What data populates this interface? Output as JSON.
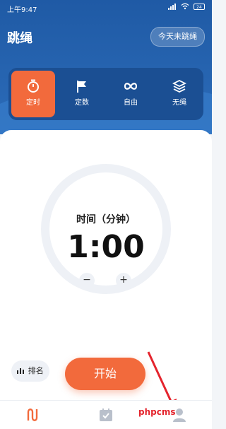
{
  "statusbar": {
    "time": "上午9:47",
    "battery": "24"
  },
  "header": {
    "title": "跳绳",
    "today_button": "今天未跳绳"
  },
  "modes": [
    {
      "label": "定时",
      "icon": "stopwatch-icon",
      "active": true
    },
    {
      "label": "定数",
      "icon": "flag-icon",
      "active": false
    },
    {
      "label": "自由",
      "icon": "infinity-icon",
      "active": false
    },
    {
      "label": "无绳",
      "icon": "layers-icon",
      "active": false
    }
  ],
  "timer": {
    "label": "时间（分钟）",
    "value": "1:00",
    "minus": "−",
    "plus": "+"
  },
  "actions": {
    "rank": "排名",
    "start": "开始"
  },
  "tabbar": [
    {
      "icon": "rope-icon",
      "active": true
    },
    {
      "icon": "calendar-check-icon",
      "active": false
    },
    {
      "icon": "profile-icon",
      "active": false
    }
  ],
  "watermark": "phpcms",
  "colors": {
    "primary": "#2c6cb9",
    "accent": "#f26a3c",
    "dark_panel": "#1b4f93"
  }
}
